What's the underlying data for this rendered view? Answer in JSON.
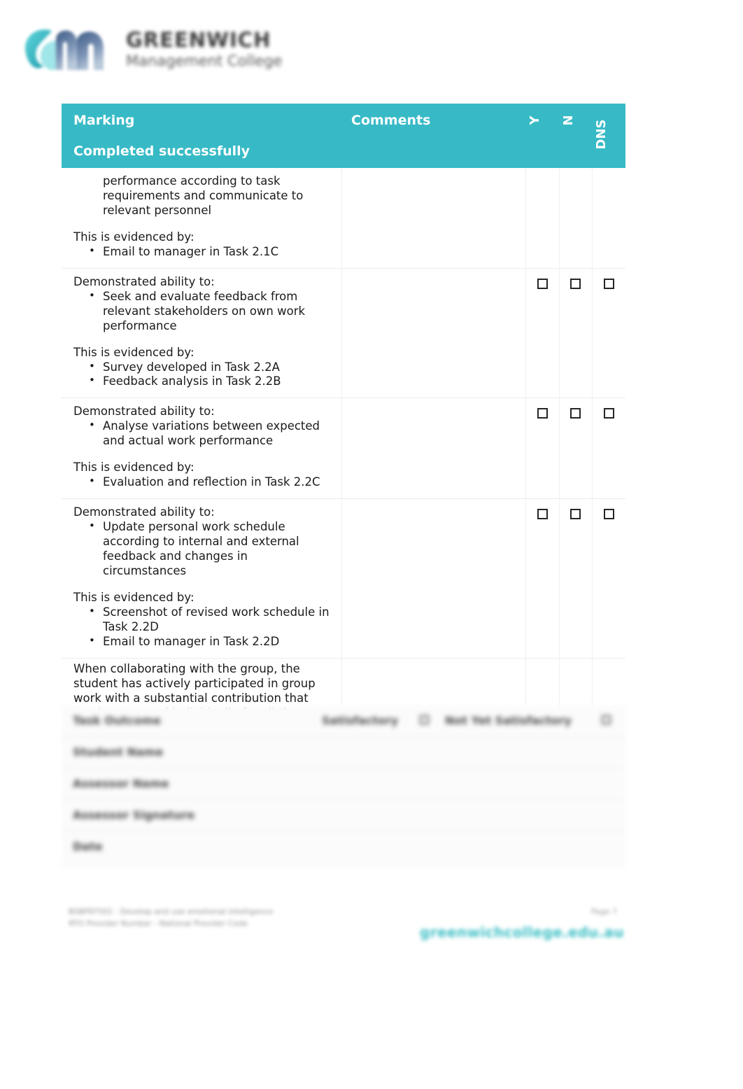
{
  "brand": {
    "logo_title": "GREENWICH",
    "logo_subtitle": "Management College",
    "teal": "#37bac6",
    "logo_icon": "gm-monogram-icon"
  },
  "table": {
    "headers": {
      "marking_line1": "Marking",
      "marking_line2": "Completed successfully",
      "comments": "Comments",
      "y": "Y",
      "n": "N",
      "dns": "DNS"
    },
    "rows": [
      {
        "lead": "",
        "continued_text": "performance according to task requirements and communicate to relevant personnel",
        "evidence_lead": "This is evidenced by:",
        "evidence": [
          "Email to manager in Task 2.1C"
        ],
        "comment": "",
        "checkboxes": [
          "",
          "",
          ""
        ],
        "show_checkboxes": false
      },
      {
        "lead": "Demonstrated ability to:",
        "bullets": [
          "Seek and evaluate feedback from relevant stakeholders on own work performance"
        ],
        "evidence_lead": "This is evidenced by:",
        "evidence": [
          "Survey developed in Task 2.2A",
          "Feedback analysis in Task 2.2B"
        ],
        "comment": "",
        "checkboxes": [
          "",
          "",
          ""
        ],
        "show_checkboxes": true
      },
      {
        "lead": "Demonstrated ability to:",
        "bullets": [
          "Analyse variations between expected and actual work performance"
        ],
        "evidence_lead": "This is evidenced by:",
        "evidence": [
          "Evaluation and reflection in Task 2.2C"
        ],
        "comment": "",
        "checkboxes": [
          "",
          "",
          ""
        ],
        "show_checkboxes": true
      },
      {
        "lead": "Demonstrated ability to:",
        "bullets": [
          "Update personal work schedule according to internal and external feedback and changes in circumstances"
        ],
        "evidence_lead": "This is evidenced by:",
        "evidence": [
          "Screenshot of revised work schedule in Task 2.2D",
          "Email to manager in Task 2.2D"
        ],
        "comment": "",
        "checkboxes": [
          "",
          "",
          ""
        ],
        "show_checkboxes": true
      }
    ],
    "group_note": "When collaborating with the group, the student has actively participated in group work with a substantial contribution that can be assessed individually for all the requirements of this task."
  },
  "signoff": {
    "task_outcome_label": "Task Outcome",
    "option_satisfactory": "Satisfactory",
    "option_not_yet": "Not Yet Satisfactory",
    "student_name_label": "Student Name",
    "assessor_name_label": "Assessor Name",
    "assessor_signature_label": "Assessor Signature",
    "date_label": "Date"
  },
  "footer": {
    "line1": "BSBPEF502 - Develop and use emotional intelligence",
    "line2": "RTO Provider Number - National Provider Code",
    "page": "Page 7",
    "url": "greenwichcollege.edu.au"
  }
}
